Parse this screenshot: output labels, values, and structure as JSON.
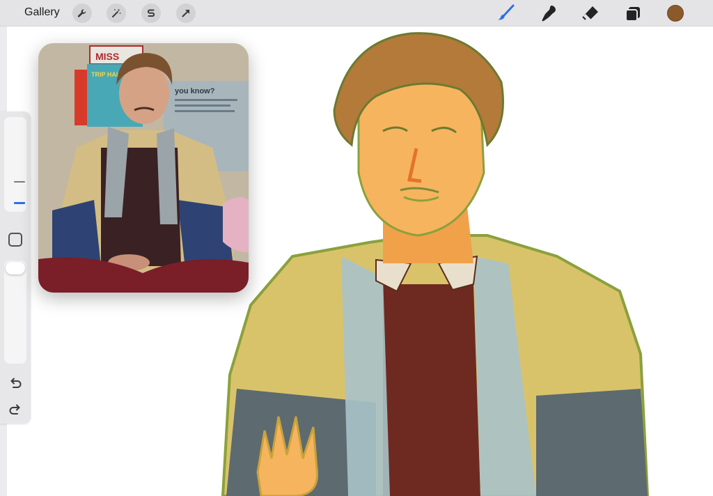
{
  "toolbar": {
    "gallery_label": "Gallery",
    "left_tools": [
      "wrench-icon",
      "magic-wand-icon",
      "selection-s-icon",
      "arrow-transform-icon"
    ],
    "right_tools": [
      "brush-icon",
      "smudge-icon",
      "eraser-icon",
      "layers-icon"
    ],
    "active_tool": "brush-icon",
    "active_color": "#8b5a2b",
    "accent_color": "#2d6fe8"
  },
  "sidebar": {
    "brush_size_level": 0.6,
    "opacity_level": 1.0,
    "icons": [
      "modify-square-icon",
      "undo-icon",
      "redo-icon"
    ]
  },
  "reference_window": {
    "poster_text_1": "MISS",
    "poster_text_2": "TRIP HAL",
    "poster_text_3": "you know?"
  }
}
